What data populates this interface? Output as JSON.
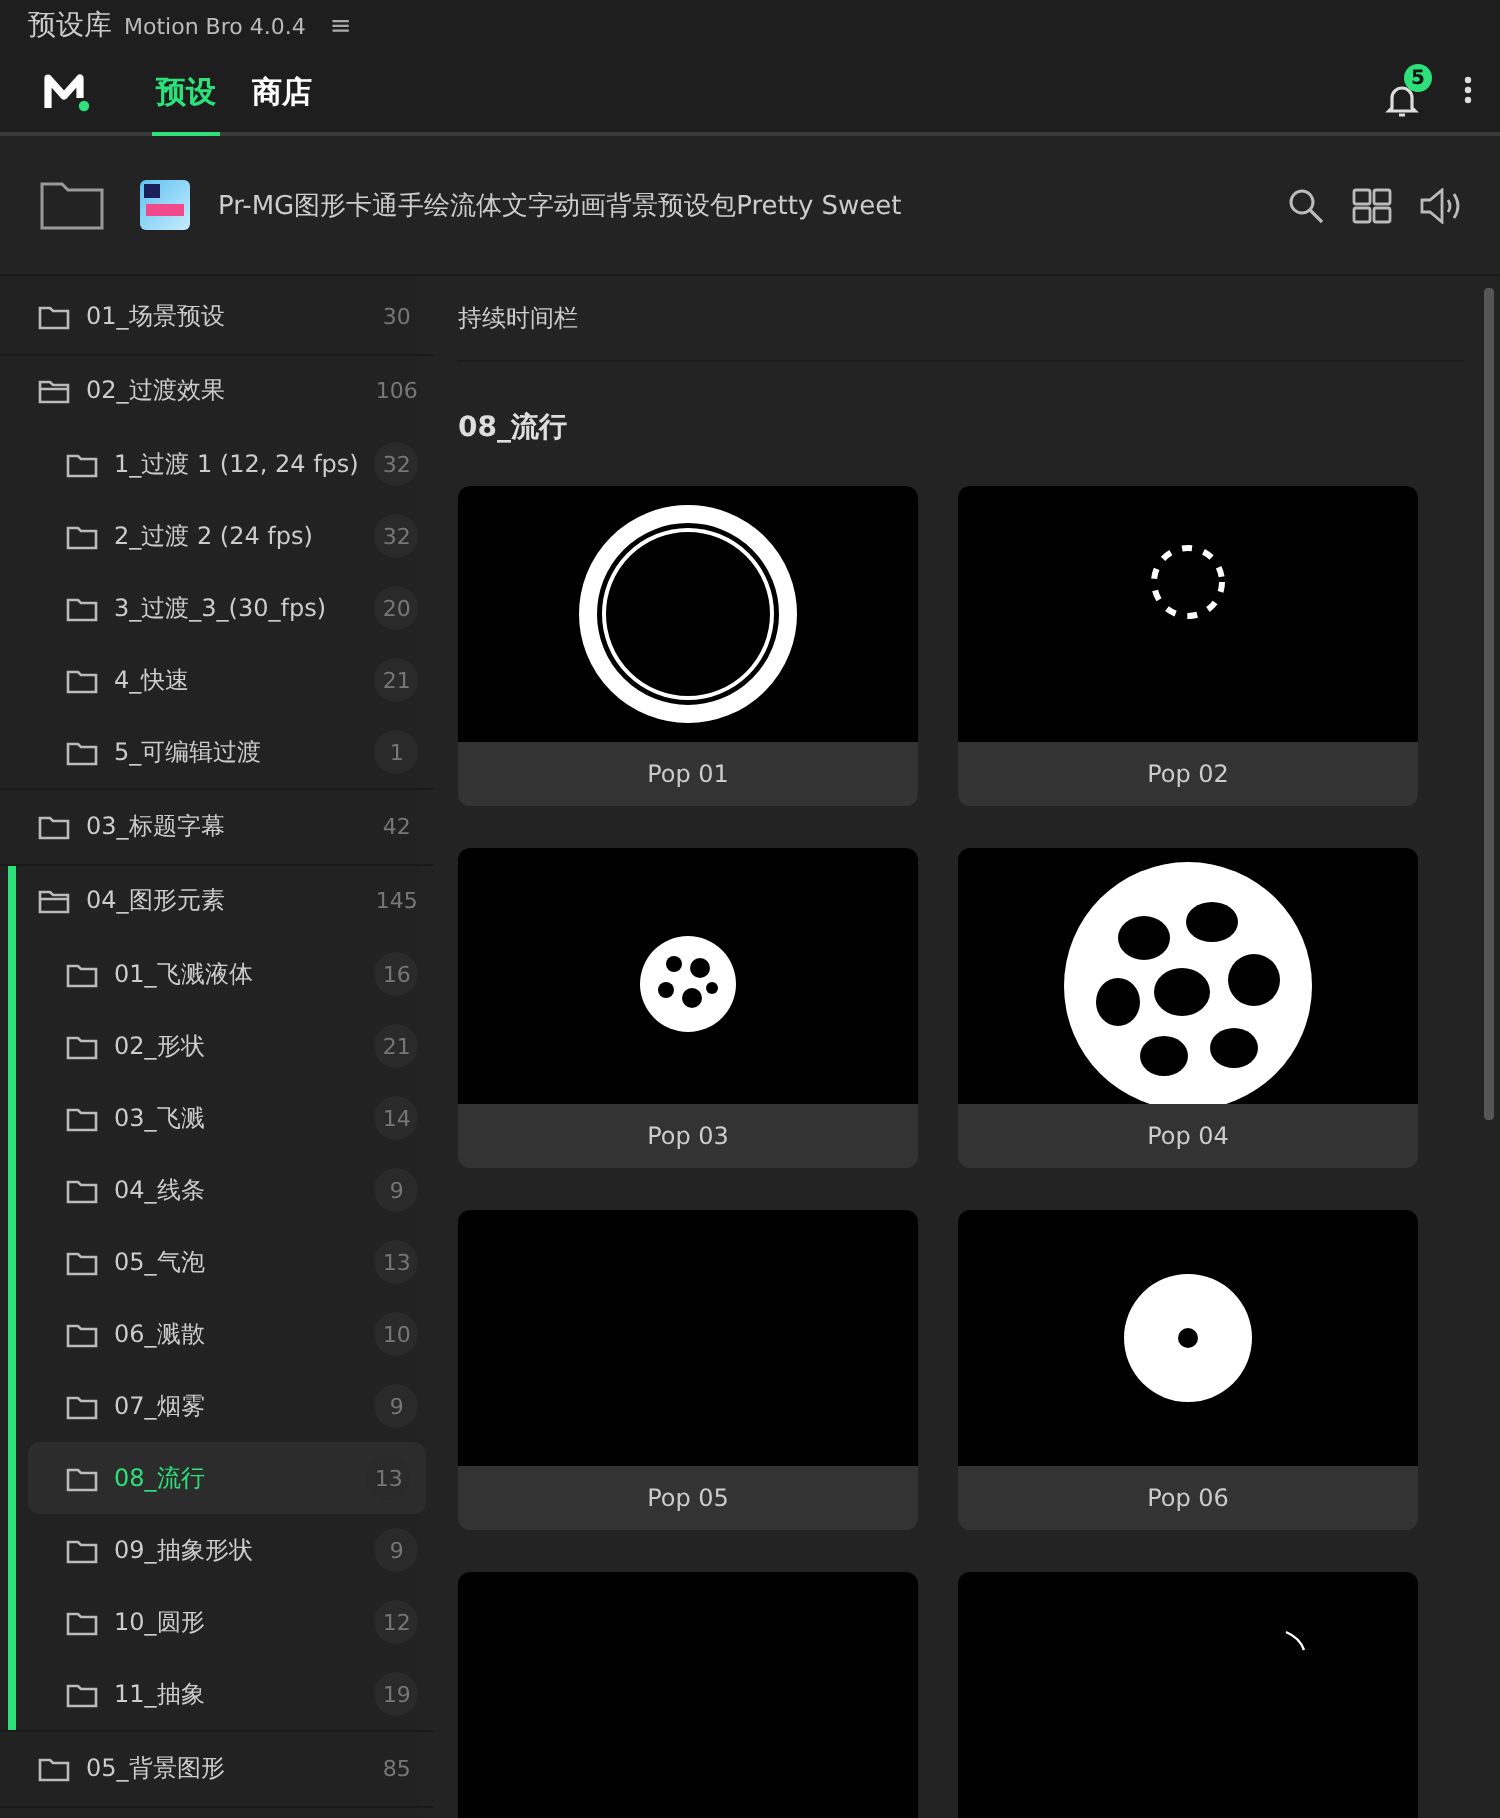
{
  "window": {
    "title": "预设库",
    "app_name": "Motion Bro 4.0.4",
    "menu_glyph": "≡"
  },
  "header": {
    "tabs": [
      {
        "label": "预设",
        "selected": true
      },
      {
        "label": "商店",
        "selected": false
      }
    ],
    "notification_count": "5"
  },
  "pack": {
    "title": "Pr-MG图形卡通手绘流体文字动画背景预设包Pretty Sweet"
  },
  "tree": [
    {
      "label": "01_场景预设",
      "count": "30",
      "expanded": false,
      "active": false
    },
    {
      "label": "02_过渡效果",
      "count": "106",
      "expanded": true,
      "active": false,
      "children": [
        {
          "label": "1_过渡 1 (12, 24 fps)",
          "count": "32",
          "selected": false
        },
        {
          "label": "2_过渡 2 (24 fps)",
          "count": "32",
          "selected": false
        },
        {
          "label": "3_过渡_3_(30_fps)",
          "count": "20",
          "selected": false
        },
        {
          "label": "4_快速",
          "count": "21",
          "selected": false
        },
        {
          "label": "5_可编辑过渡",
          "count": "1",
          "selected": false
        }
      ]
    },
    {
      "label": "03_标题字幕",
      "count": "42",
      "expanded": false,
      "active": false
    },
    {
      "label": "04_图形元素",
      "count": "145",
      "expanded": true,
      "active": true,
      "children": [
        {
          "label": "01_飞溅液体",
          "count": "16",
          "selected": false
        },
        {
          "label": "02_形状",
          "count": "21",
          "selected": false
        },
        {
          "label": "03_飞溅",
          "count": "14",
          "selected": false
        },
        {
          "label": "04_线条",
          "count": "9",
          "selected": false
        },
        {
          "label": "05_气泡",
          "count": "13",
          "selected": false
        },
        {
          "label": "06_溅散",
          "count": "10",
          "selected": false
        },
        {
          "label": "07_烟雾",
          "count": "9",
          "selected": false
        },
        {
          "label": "08_流行",
          "count": "13",
          "selected": true
        },
        {
          "label": "09_抽象形状",
          "count": "9",
          "selected": false
        },
        {
          "label": "10_圆形",
          "count": "12",
          "selected": false
        },
        {
          "label": "11_抽象",
          "count": "19",
          "selected": false
        }
      ]
    },
    {
      "label": "05_背景图形",
      "count": "85",
      "expanded": false,
      "active": false
    }
  ],
  "content": {
    "timeline_label": "持续时间栏",
    "section_title": "08_流行",
    "presets": [
      {
        "name": "Pop 01",
        "kind": "ring"
      },
      {
        "name": "Pop 02",
        "kind": "splash"
      },
      {
        "name": "Pop 03",
        "kind": "dots"
      },
      {
        "name": "Pop 04",
        "kind": "blob"
      },
      {
        "name": "Pop 05",
        "kind": "empty"
      },
      {
        "name": "Pop 06",
        "kind": "disc"
      },
      {
        "kind": "empty"
      },
      {
        "kind": "arc"
      }
    ]
  }
}
